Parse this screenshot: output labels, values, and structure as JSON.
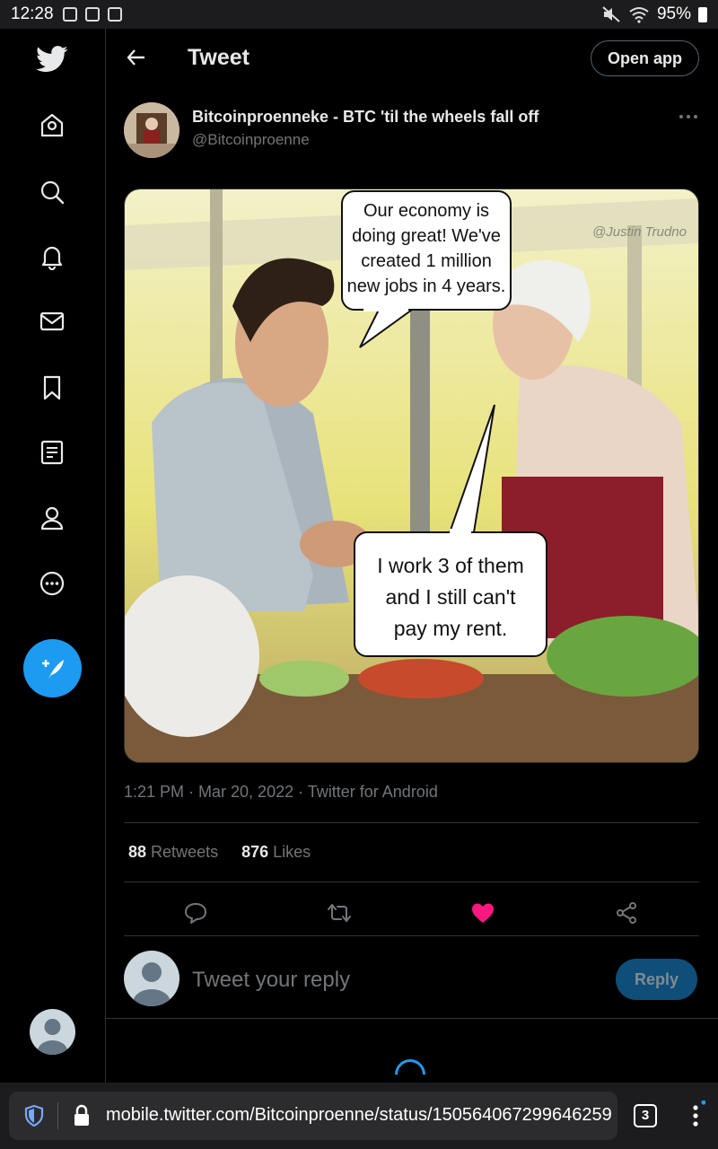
{
  "status_bar": {
    "time": "12:28",
    "battery": "95%"
  },
  "nav": {
    "items": [
      {
        "icon": "twitter-bird-icon"
      },
      {
        "icon": "home-icon"
      },
      {
        "icon": "search-icon"
      },
      {
        "icon": "bell-icon"
      },
      {
        "icon": "mail-icon"
      },
      {
        "icon": "bookmark-icon"
      },
      {
        "icon": "list-icon"
      },
      {
        "icon": "profile-icon"
      },
      {
        "icon": "more-icon"
      }
    ],
    "compose_icon": "feather-plus-icon"
  },
  "header": {
    "title": "Tweet",
    "open_app_label": "Open app"
  },
  "tweet": {
    "author_name": "Bitcoinproenneke - BTC 'til the wheels fall off",
    "author_handle": "@Bitcoinproenne",
    "image": {
      "bubble_top": [
        "Our economy is",
        "doing great! We've",
        "created 1 million",
        "new jobs in 4 years."
      ],
      "bubble_bottom": [
        "I work 3 of them",
        "and I still can't",
        "pay my rent."
      ],
      "watermark": "@Justin Trudno"
    },
    "meta": "1:21 PM · Mar 20, 2022 · Twitter for Android",
    "retweets_count": "88",
    "retweets_label": "Retweets",
    "likes_count": "876",
    "likes_label": "Likes",
    "liked": true,
    "like_color": "#f91880"
  },
  "reply": {
    "placeholder": "Tweet your reply",
    "button_label": "Reply"
  },
  "browser": {
    "url": "mobile.twitter.com/Bitcoinproenne/status/150564067299646259",
    "tab_count": "3"
  },
  "colors": {
    "accent": "#1d9bf0",
    "background": "#000000",
    "border": "#2f3336",
    "muted_text": "#71767b"
  }
}
